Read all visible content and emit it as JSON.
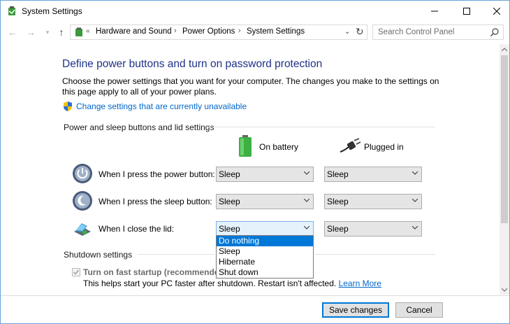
{
  "window": {
    "title": "System Settings"
  },
  "nav": {
    "breadcrumbs": [
      "Hardware and Sound",
      "Power Options",
      "System Settings"
    ],
    "search_placeholder": "Search Control Panel"
  },
  "page": {
    "title": "Define power buttons and turn on password protection",
    "description": "Choose the power settings that you want for your computer. The changes you make to the settings on this page apply to all of your power plans.",
    "change_link": "Change settings that are currently unavailable"
  },
  "power_section": {
    "label": "Power and sleep buttons and lid settings",
    "col_battery": "On battery",
    "col_plugged": "Plugged in",
    "rows": [
      {
        "label": "When I press the power button:",
        "battery": "Sleep",
        "plugged": "Sleep"
      },
      {
        "label": "When I press the sleep button:",
        "battery": "Sleep",
        "plugged": "Sleep"
      },
      {
        "label": "When I close the lid:",
        "battery": "Sleep",
        "plugged": "Sleep"
      }
    ],
    "dropdown_options": [
      "Do nothing",
      "Sleep",
      "Hibernate",
      "Shut down"
    ],
    "dropdown_highlighted": "Do nothing"
  },
  "shutdown_section": {
    "label": "Shutdown settings",
    "fast_startup_label": "Turn on fast startup (recommended)",
    "fast_startup_checked": true,
    "fast_startup_desc": "This helps start your PC faster after shutdown. Restart isn't affected.",
    "learn_more": "Learn More"
  },
  "footer": {
    "save_label": "Save changes",
    "cancel_label": "Cancel"
  },
  "colors": {
    "title_blue": "#1e3287",
    "link_blue": "#0066cc",
    "highlight": "#0078d7",
    "battery_green": "#3cb043"
  }
}
